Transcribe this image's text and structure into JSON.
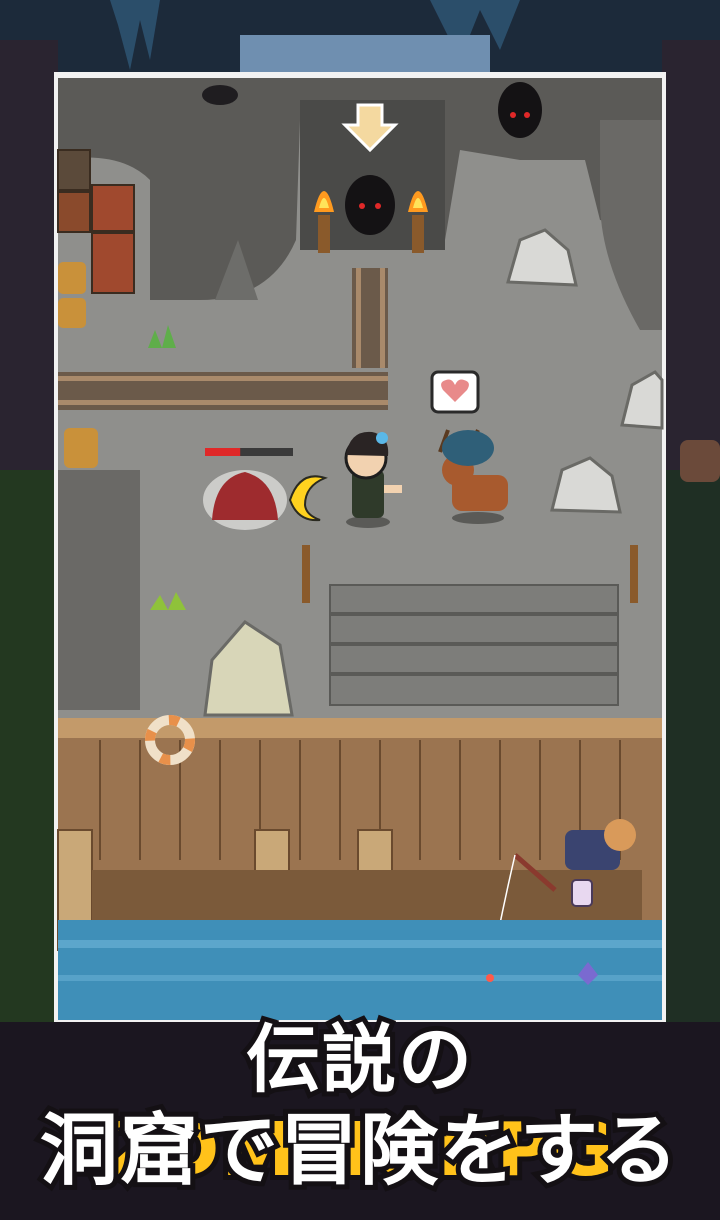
{
  "caption": {
    "line1_prefix": "伝説の",
    "line1_accent": "2DMMORPG",
    "line2": "洞窟で冒険をする"
  },
  "colors": {
    "accent": "#ffc21a",
    "caption_text": "#ffffff",
    "cave_floor": "#8f8f8c",
    "cave_wall": "#4a4a48",
    "dock_wood": "#9b7450",
    "water": "#3f8fb8",
    "enemy_hp_bar": "#e02828"
  },
  "game": {
    "enemy_hp_fraction": 0.4
  },
  "icons": [
    "down-arrow-marker",
    "heart-emote",
    "torch",
    "crescent-slash-effect",
    "life-ring",
    "fishing-rod",
    "honey-jar"
  ]
}
